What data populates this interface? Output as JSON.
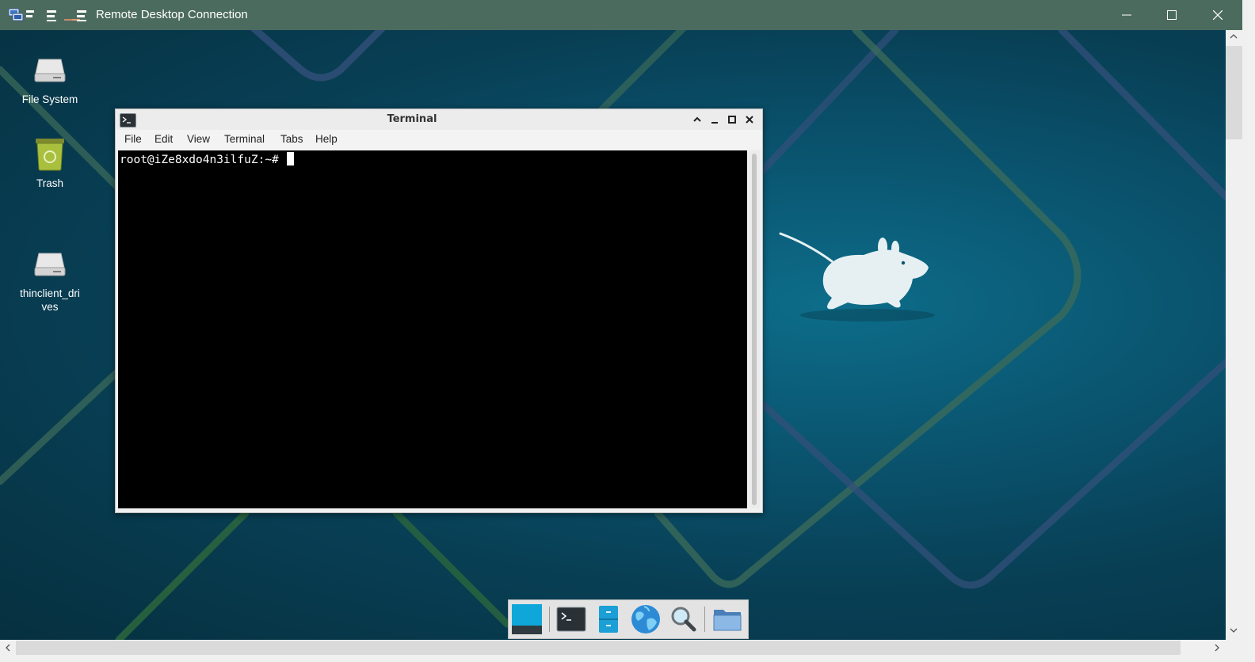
{
  "rdp": {
    "title": "Remote Desktop Connection",
    "icon": "remote-desktop-icon",
    "controls": [
      "minimize",
      "maximize",
      "close"
    ]
  },
  "desktop": {
    "icons": [
      {
        "label": "File System",
        "icon": "drive-icon"
      },
      {
        "label": "Trash",
        "icon": "trash-icon"
      },
      {
        "label": "thinclient_dri\nves",
        "icon": "drive-icon"
      }
    ]
  },
  "terminal": {
    "title": "Terminal",
    "menu": [
      "File",
      "Edit",
      "View",
      "Terminal",
      "Tabs",
      "Help"
    ],
    "prompt": "root@iZe8xdo4n3ilfuZ:~# "
  },
  "dock": {
    "items": [
      "show-desktop-icon",
      "terminal-icon",
      "file-manager-icon",
      "web-browser-icon",
      "app-finder-icon",
      "folder-icon"
    ]
  },
  "colors": {
    "rdp_titlebar": "#4c6b5f",
    "desktop_bg": "#0a5570",
    "terminal_bg": "#000000"
  }
}
